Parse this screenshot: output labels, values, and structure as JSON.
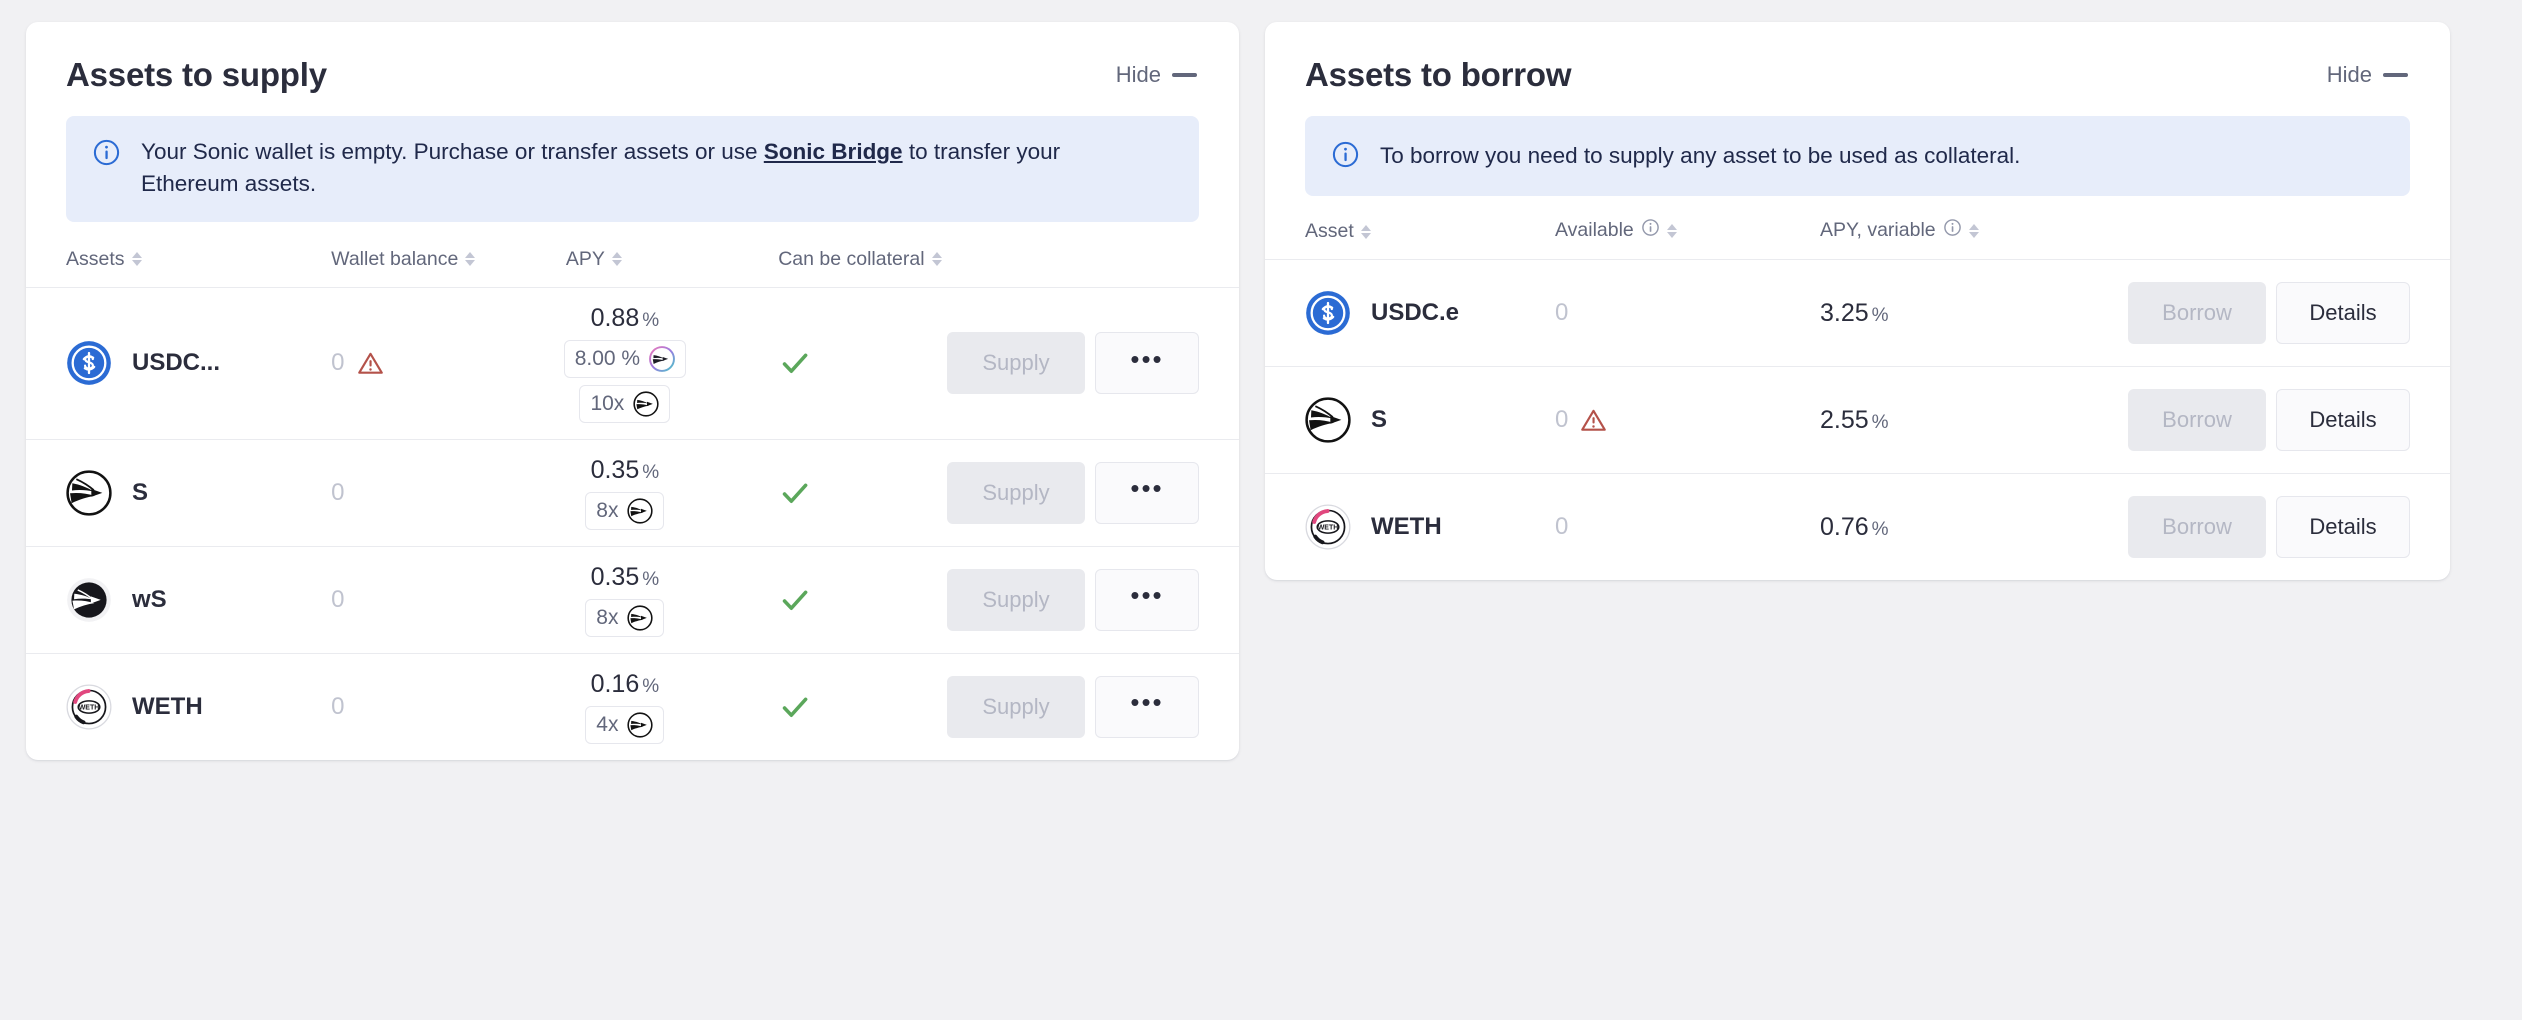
{
  "supply": {
    "title": "Assets to supply",
    "hide_label": "Hide",
    "alert": {
      "text_before": "Your Sonic wallet is empty. Purchase or transfer assets or use ",
      "link": "Sonic Bridge",
      "text_after": " to transfer your Ethereum assets."
    },
    "columns": {
      "asset": "Assets",
      "wallet_balance": "Wallet balance",
      "apy": "APY",
      "collateral": "Can be collateral"
    },
    "action_supply": "Supply",
    "action_more": "•••",
    "rows": [
      {
        "icon": "usdc-icon",
        "name": "USDC...",
        "balance": "0",
        "balance_warning": true,
        "apy": "0.88",
        "apy_unit": "%",
        "badges": [
          {
            "text": "8.00 %",
            "icon": "sonic-points-gradient-icon"
          },
          {
            "text": "10x",
            "icon": "sonic-icon"
          }
        ],
        "collateral": true,
        "supply_enabled": false
      },
      {
        "icon": "sonic-icon",
        "name": "S",
        "balance": "0",
        "balance_warning": false,
        "apy": "0.35",
        "apy_unit": "%",
        "badges": [
          {
            "text": "8x",
            "icon": "sonic-icon"
          }
        ],
        "collateral": true,
        "supply_enabled": false
      },
      {
        "icon": "wrapped-sonic-icon",
        "name": "wS",
        "balance": "0",
        "balance_warning": false,
        "apy": "0.35",
        "apy_unit": "%",
        "badges": [
          {
            "text": "8x",
            "icon": "sonic-icon"
          }
        ],
        "collateral": true,
        "supply_enabled": false
      },
      {
        "icon": "weth-icon",
        "name": "WETH",
        "balance": "0",
        "balance_warning": false,
        "apy": "0.16",
        "apy_unit": "%",
        "badges": [
          {
            "text": "4x",
            "icon": "sonic-icon"
          }
        ],
        "collateral": true,
        "supply_enabled": false
      }
    ]
  },
  "borrow": {
    "title": "Assets to borrow",
    "hide_label": "Hide",
    "alert": {
      "text": "To borrow you need to supply any asset to be used as collateral."
    },
    "columns": {
      "asset": "Asset",
      "available": "Available",
      "apy_variable": "APY, variable"
    },
    "action_borrow": "Borrow",
    "action_details": "Details",
    "rows": [
      {
        "icon": "usdc-icon",
        "name": "USDC.e",
        "available": "0",
        "available_warning": false,
        "apy": "3.25",
        "apy_unit": "%",
        "borrow_enabled": false
      },
      {
        "icon": "sonic-icon",
        "name": "S",
        "available": "0",
        "available_warning": true,
        "apy": "2.55",
        "apy_unit": "%",
        "borrow_enabled": false
      },
      {
        "icon": "weth-icon",
        "name": "WETH",
        "available": "0",
        "available_warning": false,
        "apy": "0.76",
        "apy_unit": "%",
        "borrow_enabled": false
      }
    ]
  },
  "colors": {
    "page_bg": "#f1f1f3",
    "card_bg": "#ffffff",
    "alert_bg": "#e7edfa",
    "accent_blue": "#2b6bd4",
    "text_dark": "#2b2d3c",
    "text_muted": "#62677b",
    "success_green": "#5ba75b",
    "warning_red": "#b4524a",
    "disabled_bg": "#e9eaee"
  }
}
